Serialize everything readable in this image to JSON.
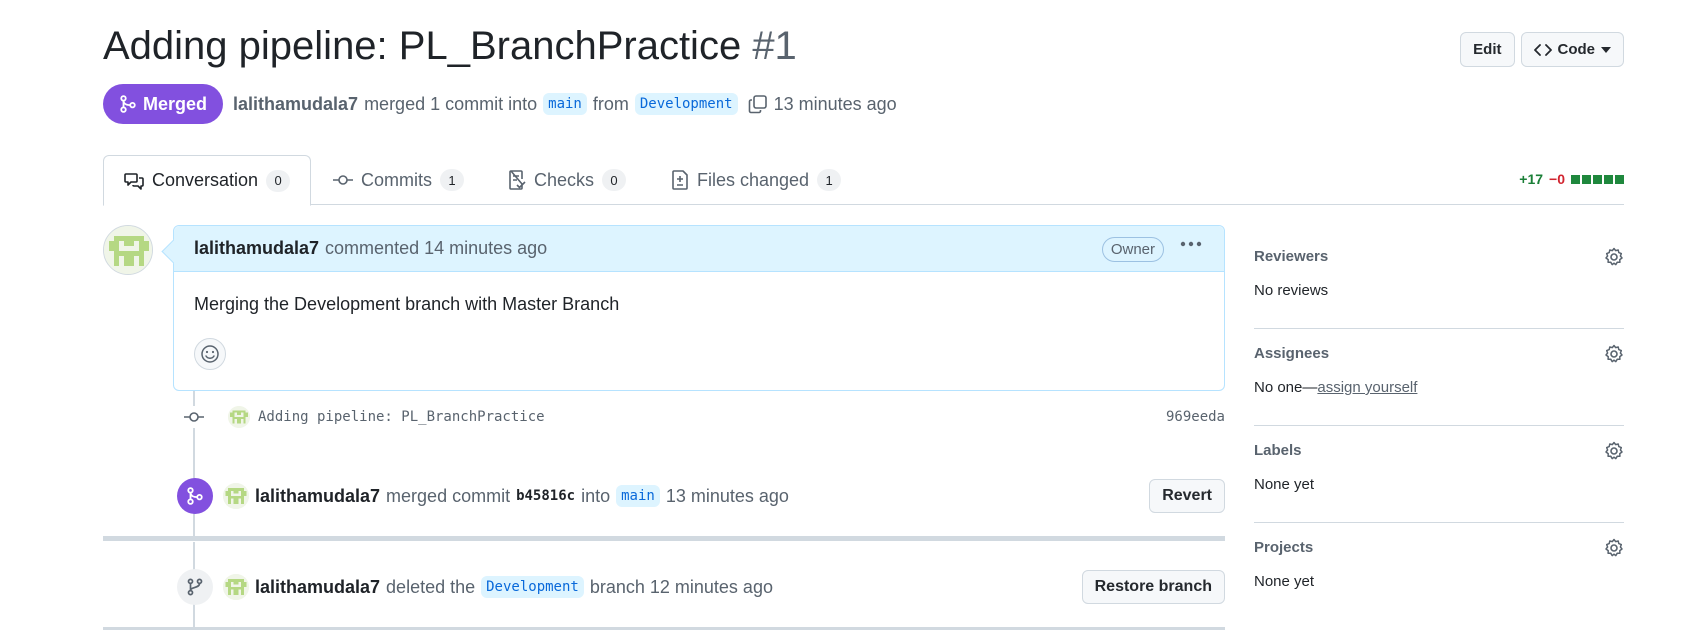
{
  "header": {
    "title": "Adding pipeline: PL_BranchPractice",
    "number": "#1",
    "edit_label": "Edit",
    "code_label": "Code"
  },
  "meta": {
    "state_label": "Merged",
    "author": "lalithamudala7",
    "merged_text": "merged 1 commit into",
    "base_branch": "main",
    "from_text": "from",
    "head_branch": "Development",
    "time": "13 minutes ago"
  },
  "tabs": [
    {
      "label": "Conversation",
      "count": "0"
    },
    {
      "label": "Commits",
      "count": "1"
    },
    {
      "label": "Checks",
      "count": "0"
    },
    {
      "label": "Files changed",
      "count": "1"
    }
  ],
  "diffstat": {
    "additions": "+17",
    "deletions": "−0"
  },
  "comment": {
    "author": "lalithamudala7",
    "action": "commented 14 minutes ago",
    "role_badge": "Owner",
    "body": "Merging the Development branch with Master Branch"
  },
  "commit": {
    "message": "Adding pipeline: PL_BranchPractice",
    "sha": "969eeda"
  },
  "merge_event": {
    "author": "lalithamudala7",
    "text1": "merged commit",
    "sha": "b45816c",
    "text2": "into",
    "branch": "main",
    "time": "13 minutes ago",
    "button": "Revert"
  },
  "delete_event": {
    "author": "lalithamudala7",
    "text1": "deleted the",
    "branch": "Development",
    "text2": "branch 12 minutes ago",
    "button": "Restore branch"
  },
  "sidebar": {
    "reviewers": {
      "title": "Reviewers",
      "value": "No reviews"
    },
    "assignees": {
      "title": "Assignees",
      "value_prefix": "No one—",
      "link": "assign yourself"
    },
    "labels": {
      "title": "Labels",
      "value": "None yet"
    },
    "projects": {
      "title": "Projects",
      "value": "None yet"
    }
  },
  "colors": {
    "merged": "#8250df",
    "accent_blue": "#0969da",
    "add": "#1a7f37",
    "delete": "#d1242f"
  }
}
